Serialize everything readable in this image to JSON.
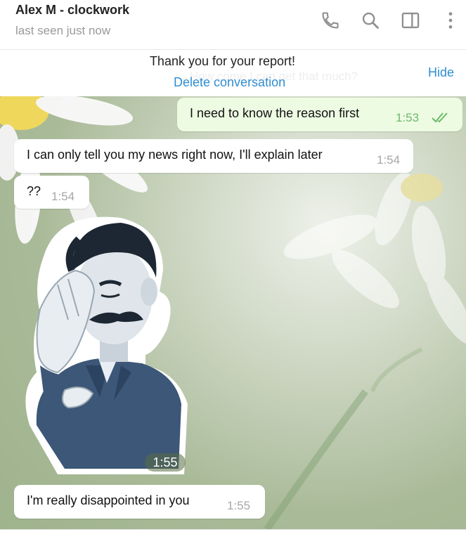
{
  "header": {
    "title": "Alex M - clockwork",
    "status": "last seen just now",
    "icons": [
      "phone-icon",
      "search-icon",
      "sidebar-toggle-icon",
      "more-vert-icon"
    ]
  },
  "report_bar": {
    "message": "Thank you for your report!",
    "delete_label": "Delete conversation",
    "hide_label": "Hide",
    "ghost_text": "How come I can get that much?"
  },
  "messages": [
    {
      "direction": "out",
      "text": "I need to know the reason first",
      "time": "1:53",
      "read": true
    },
    {
      "direction": "in",
      "text": "I can only tell you my news right now, I'll explain later",
      "time": "1:54"
    },
    {
      "direction": "in",
      "text": "??",
      "time": "1:54"
    },
    {
      "direction": "in",
      "type": "sticker",
      "sticker": "facepalm-man-sticker",
      "time": "1:55"
    },
    {
      "direction": "in",
      "text": "I'm really disappointed in you",
      "time": "1:55"
    }
  ],
  "colors": {
    "accent": "#2f8ed1",
    "outgoing_bubble": "#eefbe3",
    "read_check": "#6cb96a"
  }
}
